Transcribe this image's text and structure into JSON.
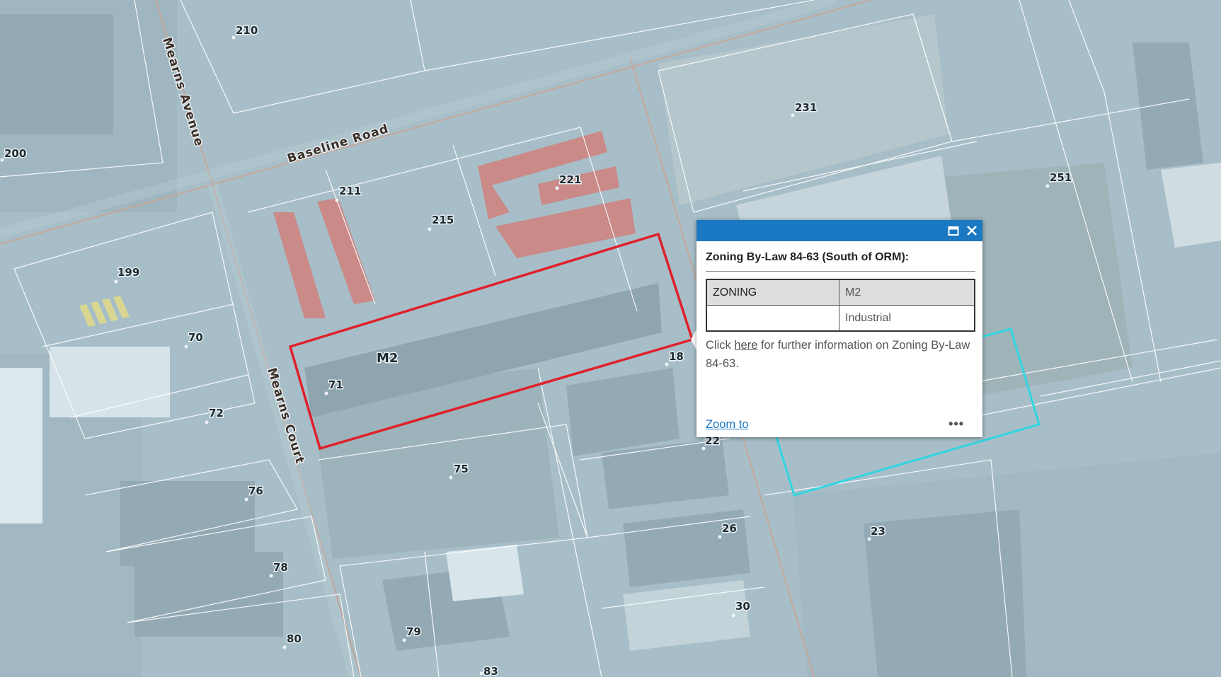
{
  "map": {
    "roads": [
      {
        "id": "baseline-road",
        "label": "Baseline Road"
      },
      {
        "id": "mearns-avenue",
        "label": "Mearns Avenue"
      },
      {
        "id": "mearns-court",
        "label": "Mearns Court"
      }
    ],
    "addresses": [
      "210",
      "200",
      "231",
      "251",
      "221",
      "211",
      "215",
      "199",
      "70",
      "72",
      "71",
      "18",
      "76",
      "75",
      "22",
      "26",
      "23",
      "78",
      "79",
      "80",
      "30",
      "83"
    ],
    "zone_label": "M2",
    "colors": {
      "selected_parcel": "#e0202a",
      "adjacent_parcel": "#2fd6e0",
      "parcel_lines": "#ffffff"
    }
  },
  "popup": {
    "title": "Zoning By-Law 84-63 (South of ORM):",
    "maximize_icon": "maximize-icon",
    "close_icon": "close-icon",
    "fields": [
      {
        "name": "ZONING",
        "value": "M2"
      },
      {
        "name": "",
        "value": "Industrial"
      }
    ],
    "description_prefix": "Click ",
    "link_text": "here",
    "description_suffix": " for further information on Zoning By-Law 84-63.",
    "zoom_label": "Zoom to",
    "more_label": "•••",
    "header_color": "#1b78c2"
  }
}
